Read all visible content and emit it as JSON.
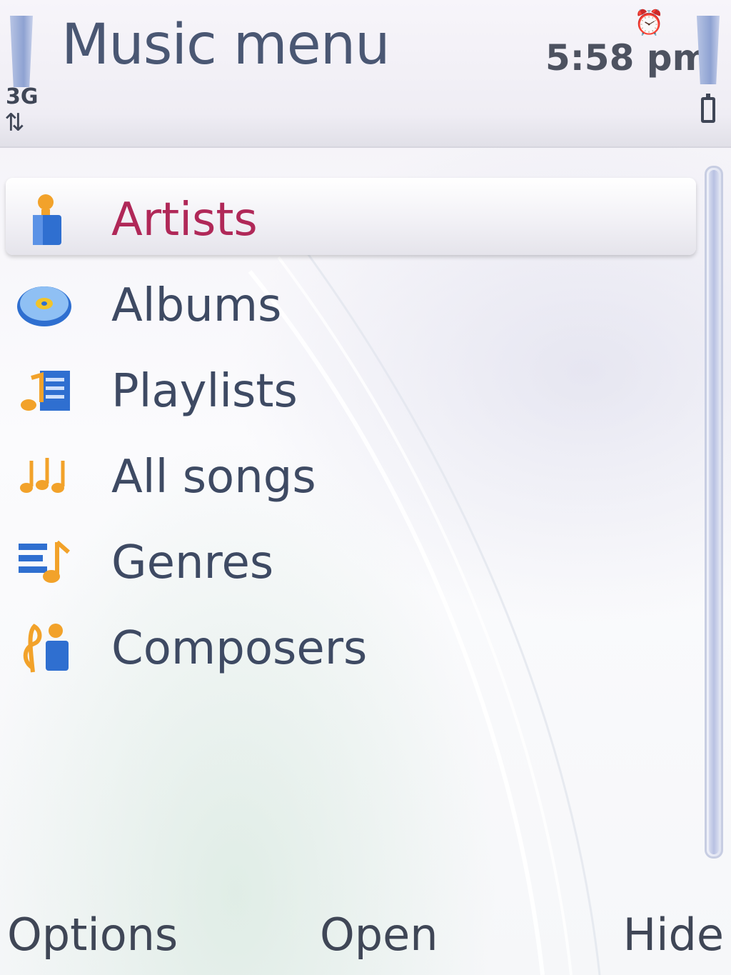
{
  "status_bar": {
    "title": "Music menu",
    "time": "5:58 pm",
    "network": "3G",
    "network_arrows": "⇅",
    "alarm_glyph": "⏰"
  },
  "menu": {
    "items": [
      {
        "label": "Artists",
        "icon": "artist-icon",
        "selected": true
      },
      {
        "label": "Albums",
        "icon": "album-disc-icon",
        "selected": false
      },
      {
        "label": "Playlists",
        "icon": "playlist-icon",
        "selected": false
      },
      {
        "label": "All songs",
        "icon": "all-songs-icon",
        "selected": false
      },
      {
        "label": "Genres",
        "icon": "genres-icon",
        "selected": false
      },
      {
        "label": "Composers",
        "icon": "composers-icon",
        "selected": false
      }
    ]
  },
  "softkeys": {
    "left": "Options",
    "middle": "Open",
    "right": "Hide"
  },
  "colors": {
    "title": "#4a5773",
    "selected_label": "#b02858",
    "label": "#3e4a63",
    "icon_blue": "#2f6fd0",
    "icon_orange": "#f2a22a"
  }
}
